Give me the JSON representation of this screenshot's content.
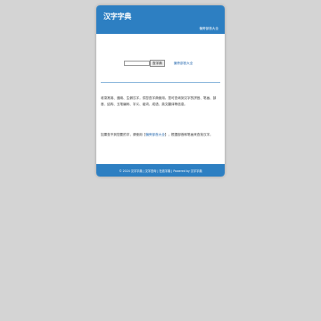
{
  "header": {
    "logo": "汉字字典",
    "nav_link": "偏旁部首大全"
  },
  "search": {
    "input_value": "",
    "button_label": "查字典",
    "side_link": "偏旁部首大全"
  },
  "intro": {
    "text": "收录常用、通用、生僻汉字，供您查字典使用。您可查询到汉字的拼音、笔画、部首、结构、五笔编码、字义、组词、成语、英文翻译等信息。"
  },
  "note": {
    "before": "如果查不到您要的字，请使用【",
    "link": "偏旁部首大全",
    "after": "】，根据部首和笔画来查找汉字。"
  },
  "footer": {
    "text": "© 2024 汉字字典 | 汉字查询 | 在线字典 | Powered by 汉字字典"
  },
  "colors": {
    "background": "#d4d4d4",
    "header": "#2d7fc2",
    "link": "#2b6cb0"
  }
}
